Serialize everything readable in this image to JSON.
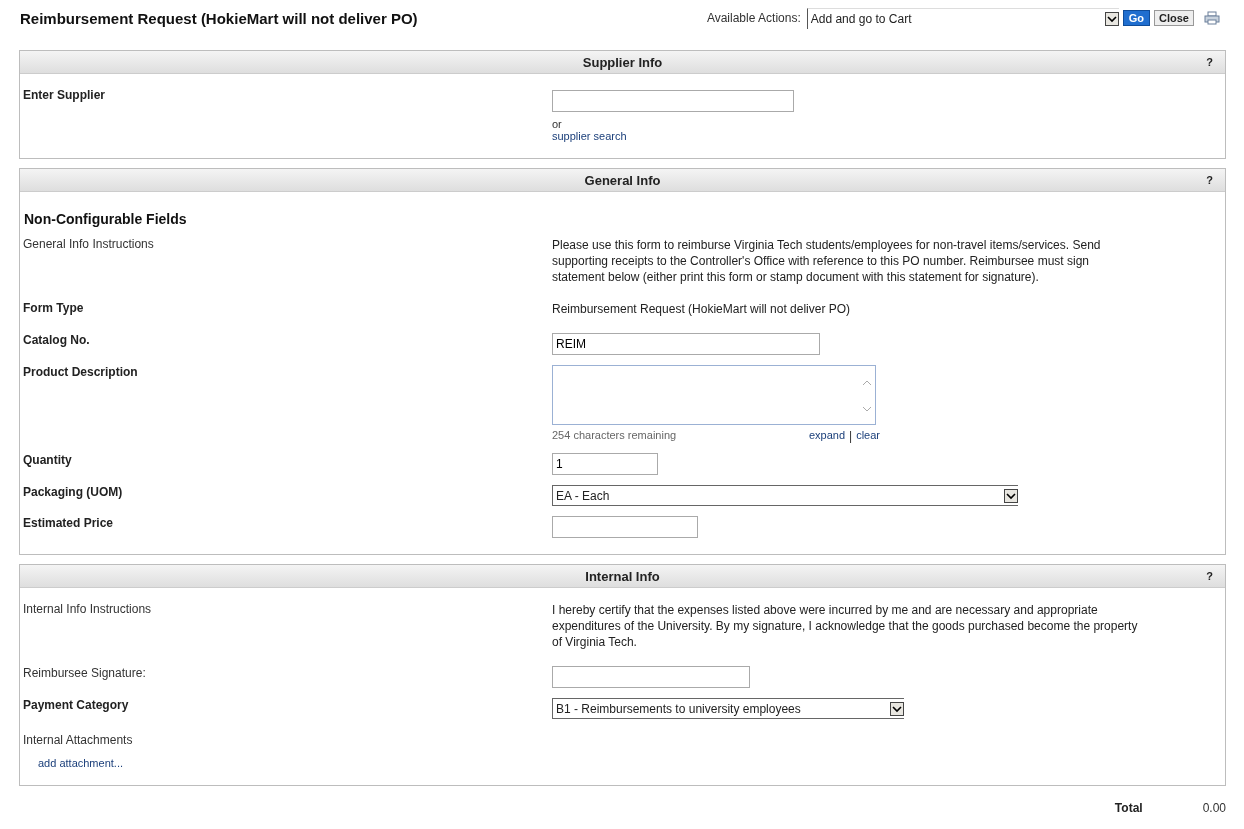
{
  "header": {
    "title": "Reimbursement Request (HokieMart will not deliver PO)",
    "actions_label": "Available Actions:",
    "action_value": "Add and go to Cart",
    "go": "Go",
    "close": "Close"
  },
  "sections": [
    {
      "title": "Supplier Info",
      "help": "?",
      "rows": [
        {
          "kind": "supplier",
          "label": "Enter Supplier",
          "strong": true,
          "or": "or",
          "link": "supplier search"
        }
      ]
    },
    {
      "title": "General Info",
      "help": "?",
      "subheading": "Non-Configurable Fields",
      "rows": [
        {
          "kind": "text",
          "label": "General Info Instructions",
          "strong": false,
          "text": "Please use this form to reimburse Virginia Tech students/employees for non-travel items/services. Send supporting receipts to the Controller's Office with reference to this PO number. Reimbursee must sign statement below (either print this form or stamp document with this statement for signature)."
        },
        {
          "kind": "text",
          "label": "Form Type",
          "strong": true,
          "text": "Reimbursement Request (HokieMart will not deliver PO)"
        },
        {
          "kind": "input",
          "label": "Catalog No.",
          "strong": true,
          "value": "REIM"
        },
        {
          "kind": "textarea",
          "label": "Product Description",
          "strong": true,
          "counter": "254 characters remaining",
          "links": [
            "expand",
            "clear"
          ],
          "separator": "|"
        },
        {
          "kind": "input",
          "label": "Quantity",
          "strong": true,
          "value": "1"
        },
        {
          "kind": "select",
          "label": "Packaging (UOM)",
          "strong": true,
          "value": "EA - Each"
        },
        {
          "kind": "input",
          "label": "Estimated Price",
          "strong": true
        }
      ]
    },
    {
      "title": "Internal Info",
      "help": "?",
      "rows": [
        {
          "kind": "text",
          "label": "Internal Info Instructions",
          "strong": false,
          "text": "I hereby certify that the expenses listed above were incurred by me and are necessary and appropriate expenditures of the University. By my signature, I acknowledge that the goods purchased become the property of Virginia Tech."
        },
        {
          "kind": "input",
          "label": "Reimbursee Signature:",
          "strong": false
        },
        {
          "kind": "select",
          "label": "Payment Category",
          "strong": true,
          "value": "B1 - Reimbursements to university employees"
        },
        {
          "kind": "attachments",
          "label": "Internal Attachments",
          "strong": false,
          "link": "add attachment..."
        }
      ]
    }
  ],
  "total": {
    "label": "Total",
    "value": "0.00"
  }
}
